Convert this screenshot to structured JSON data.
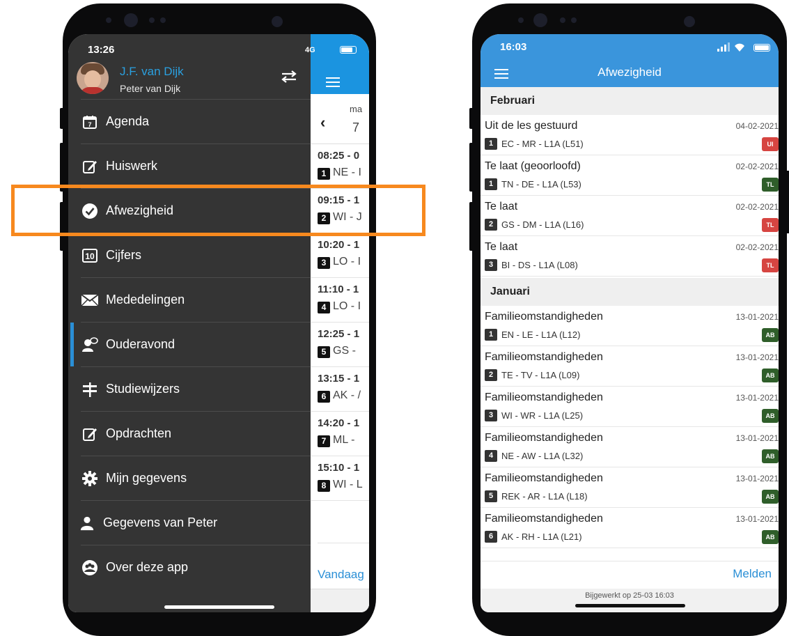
{
  "left_phone": {
    "status_time": "13:26",
    "network": "4G",
    "user": {
      "name": "J.F. van Dijk",
      "child": "Peter van Dijk"
    },
    "menu": [
      {
        "label": "Agenda",
        "icon": "calendar-icon"
      },
      {
        "label": "Huiswerk",
        "icon": "edit-icon"
      },
      {
        "label": "Afwezigheid",
        "icon": "check-circle-icon"
      },
      {
        "label": "Cijfers",
        "icon": "grades-icon"
      },
      {
        "label": "Mededelingen",
        "icon": "envelope-icon"
      },
      {
        "label": "Ouderavond",
        "icon": "user-chat-icon"
      },
      {
        "label": "Studiewijzers",
        "icon": "signpost-icon"
      },
      {
        "label": "Opdrachten",
        "icon": "edit-icon"
      },
      {
        "label": "Mijn gegevens",
        "icon": "gear-icon"
      },
      {
        "label": "Gegevens van Peter",
        "icon": "user-icon"
      },
      {
        "label": "Over deze app",
        "icon": "group-icon"
      }
    ],
    "calendar_peek": {
      "day_name": "ma",
      "day_number": "7",
      "slots": [
        {
          "time": "08:25 - 0",
          "num": "1",
          "text": "NE - I"
        },
        {
          "time": "09:15 - 1",
          "num": "2",
          "text": "WI - J"
        },
        {
          "time": "10:20 - 1",
          "num": "3",
          "text": "LO - I"
        },
        {
          "time": "11:10 - 1",
          "num": "4",
          "text": "LO - I"
        },
        {
          "time": "12:25 - 1",
          "num": "5",
          "text": "GS -"
        },
        {
          "time": "13:15 - 1",
          "num": "6",
          "text": "AK - /"
        },
        {
          "time": "14:20 - 1",
          "num": "7",
          "text": "ML -"
        },
        {
          "time": "15:10 - 1",
          "num": "8",
          "text": "WI - L"
        }
      ],
      "today_label": "Vandaag"
    }
  },
  "right_phone": {
    "status_time": "16:03",
    "title": "Afwezigheid",
    "sections": [
      {
        "label": "Februari",
        "rows": [
          {
            "title": "Uit de les gestuurd",
            "date": "04-02-2021",
            "num": "1",
            "sub": "EC - MR - L1A (L51)",
            "tag": "UI",
            "tag_color": "#d64541"
          },
          {
            "title": "Te laat (geoorloofd)",
            "date": "02-02-2021",
            "num": "1",
            "sub": "TN - DE - L1A (L53)",
            "tag": "TL",
            "tag_color": "#2f5e2a"
          },
          {
            "title": "Te laat",
            "date": "02-02-2021",
            "num": "2",
            "sub": "GS - DM - L1A (L16)",
            "tag": "TL",
            "tag_color": "#d64541"
          },
          {
            "title": "Te laat",
            "date": "02-02-2021",
            "num": "3",
            "sub": "BI - DS - L1A (L08)",
            "tag": "TL",
            "tag_color": "#d64541"
          }
        ]
      },
      {
        "label": "Januari",
        "rows": [
          {
            "title": "Familieomstandigheden",
            "date": "13-01-2021",
            "num": "1",
            "sub": "EN - LE - L1A (L12)",
            "tag": "AB",
            "tag_color": "#2f5e2a"
          },
          {
            "title": "Familieomstandigheden",
            "date": "13-01-2021",
            "num": "2",
            "sub": "TE - TV - L1A (L09)",
            "tag": "AB",
            "tag_color": "#2f5e2a"
          },
          {
            "title": "Familieomstandigheden",
            "date": "13-01-2021",
            "num": "3",
            "sub": "WI - WR - L1A (L25)",
            "tag": "AB",
            "tag_color": "#2f5e2a"
          },
          {
            "title": "Familieomstandigheden",
            "date": "13-01-2021",
            "num": "4",
            "sub": "NE - AW - L1A (L32)",
            "tag": "AB",
            "tag_color": "#2f5e2a"
          },
          {
            "title": "Familieomstandigheden",
            "date": "13-01-2021",
            "num": "5",
            "sub": "REK - AR - L1A (L18)",
            "tag": "AB",
            "tag_color": "#2f5e2a"
          },
          {
            "title": "Familieomstandigheden",
            "date": "13-01-2021",
            "num": "6",
            "sub": "AK - RH - L1A (L21)",
            "tag": "AB",
            "tag_color": "#2f5e2a"
          }
        ]
      }
    ],
    "melden_label": "Melden",
    "updated_label": "Bijgewerkt op 25-03 16:03"
  },
  "colors": {
    "accent": "#2a8fd6",
    "highlight": "#f7891e",
    "drawer_bg": "#343434"
  }
}
